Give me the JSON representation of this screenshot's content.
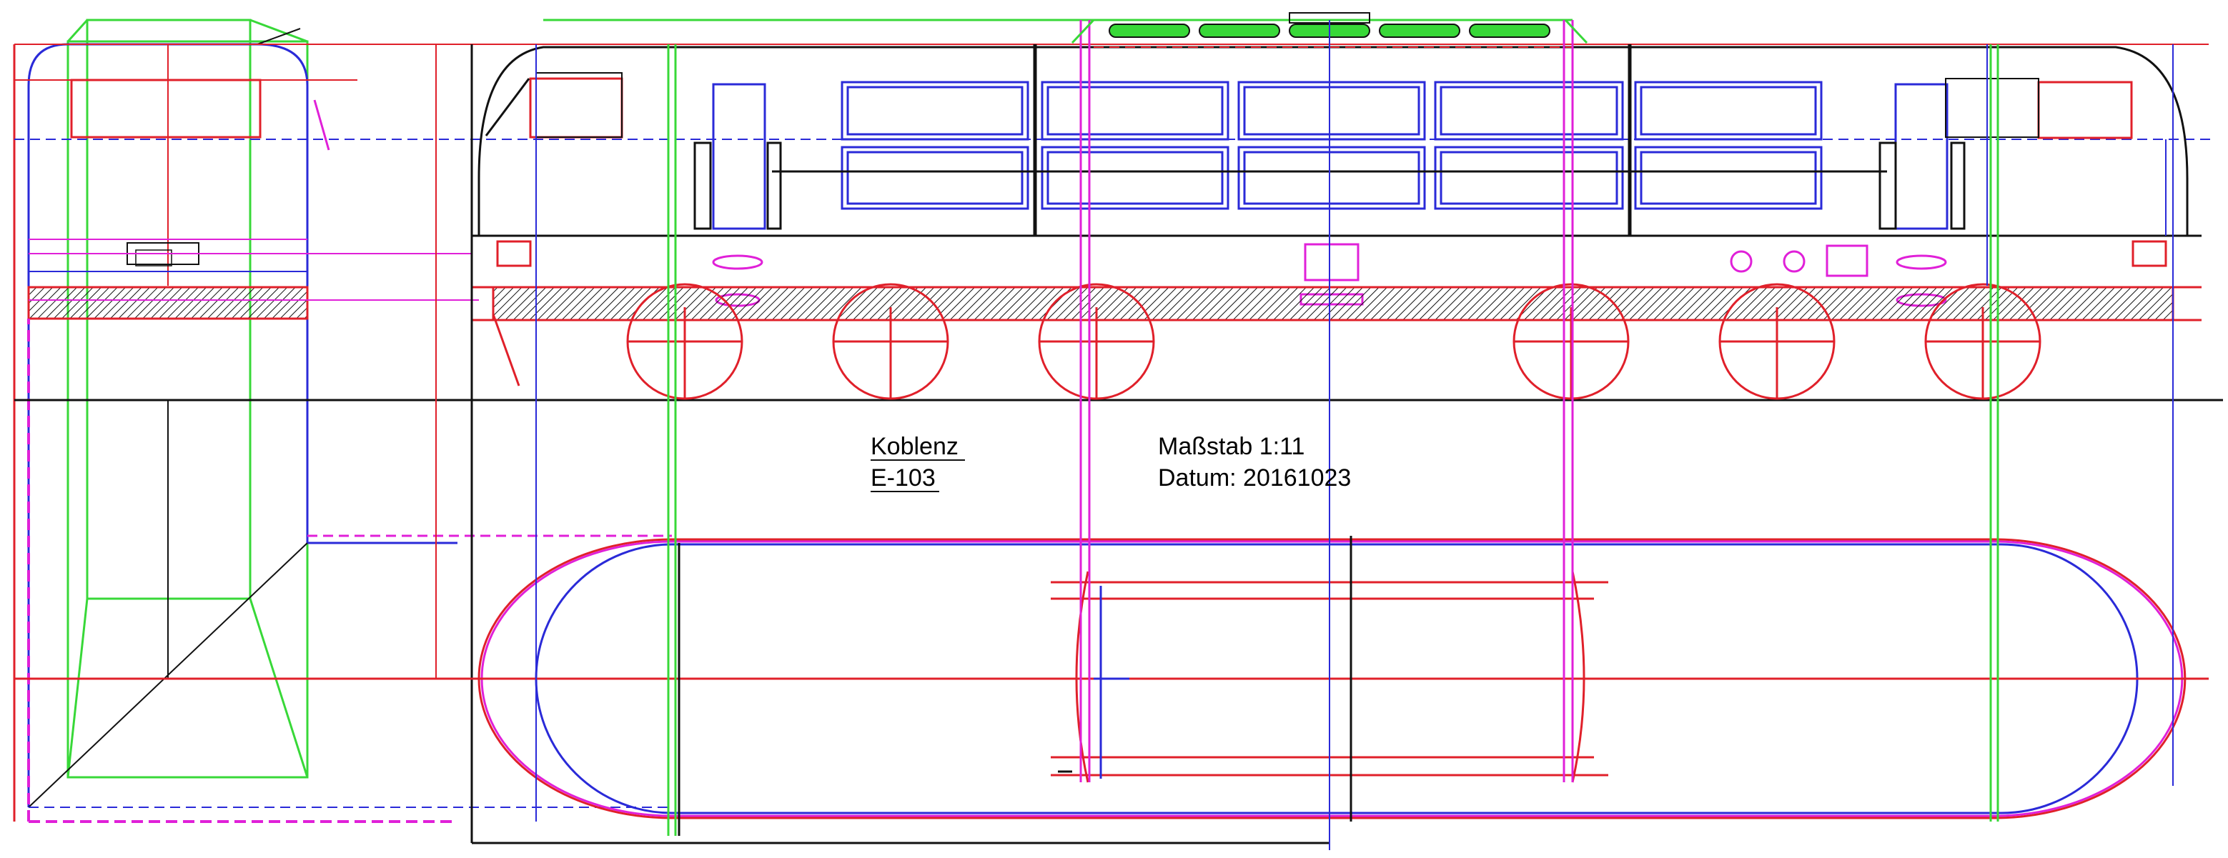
{
  "title_block": {
    "name": "Koblenz",
    "number": "E-103",
    "scale_label": "Maßstab 1:11",
    "date_label": "Datum: 20161023"
  },
  "colors": {
    "red": "#e0202a",
    "blue": "#2a2ad8",
    "green": "#38d838",
    "magenta": "#e020d8",
    "black": "#111111",
    "background": "#ffffff"
  }
}
